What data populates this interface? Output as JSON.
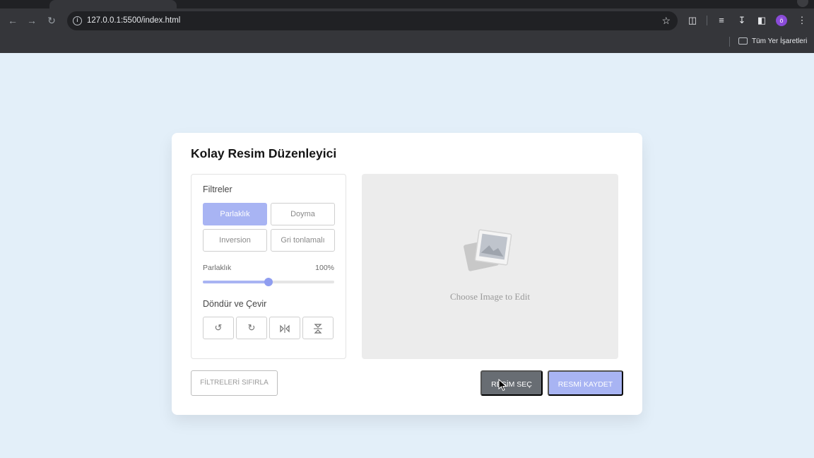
{
  "browser": {
    "url": "127.0.0.1:5500/index.html",
    "profile_initial": "ö",
    "bookmarks_label": "Tüm Yer İşaretleri"
  },
  "app": {
    "title": "Kolay Resim Düzenleyici",
    "filters": {
      "heading": "Filtreler",
      "buttons": [
        {
          "label": "Parlaklık",
          "active": true
        },
        {
          "label": "Doyma",
          "active": false
        },
        {
          "label": "Inversion",
          "active": false
        },
        {
          "label": "Gri tonlamalı",
          "active": false
        }
      ],
      "slider": {
        "label": "Parlaklık",
        "value_text": "100%",
        "value": 50,
        "max": 100
      }
    },
    "rotate": {
      "heading": "Döndür ve Çevir",
      "icons": [
        "rotate-left-icon",
        "rotate-right-icon",
        "flip-horizontal-icon",
        "flip-vertical-icon"
      ]
    },
    "preview": {
      "placeholder": "Choose Image to Edit"
    },
    "actions": {
      "reset_label": "FİLTRELERİ SIFIRLA",
      "choose_label": "RESİM SEÇ",
      "save_label": "RESMİ KAYDET"
    },
    "colors": {
      "accent": "#a8b4f3",
      "dark_button": "#686d73",
      "background": "#e3eff9"
    }
  }
}
